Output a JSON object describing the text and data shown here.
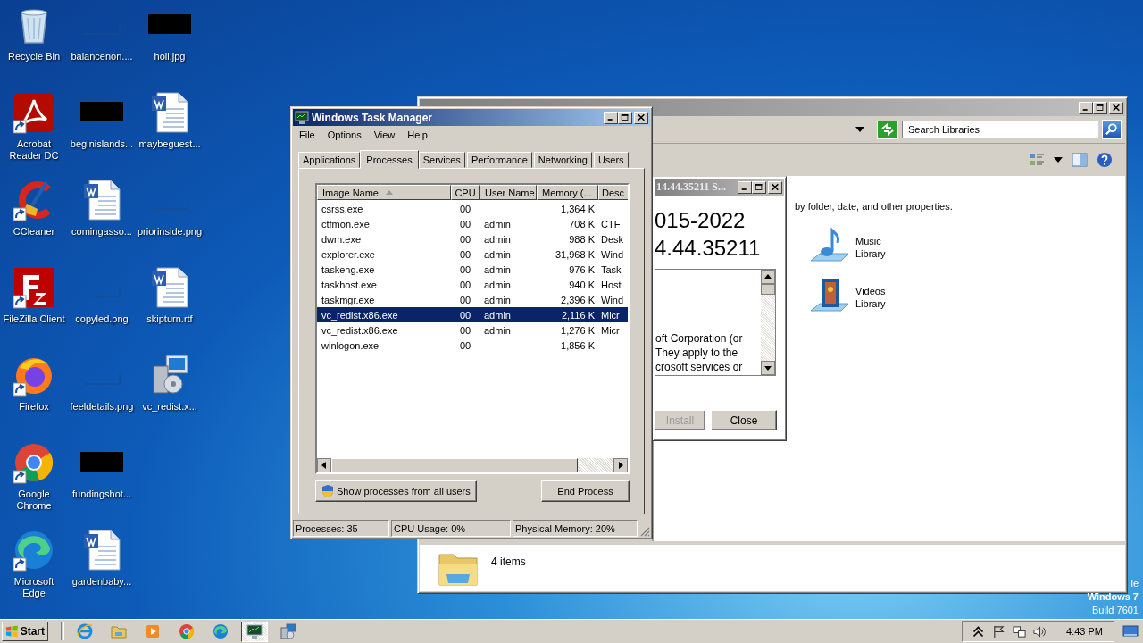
{
  "desktop_icons": [
    {
      "label": "Recycle Bin",
      "kind": "recycle",
      "shortcut": false
    },
    {
      "label": "Acrobat Reader DC",
      "kind": "pdf",
      "shortcut": true
    },
    {
      "label": "CCleaner",
      "kind": "ccleaner",
      "shortcut": true
    },
    {
      "label": "FileZilla Client",
      "kind": "filezilla",
      "shortcut": true
    },
    {
      "label": "Firefox",
      "kind": "firefox",
      "shortcut": true
    },
    {
      "label": "Google Chrome",
      "kind": "chrome",
      "shortcut": true
    },
    {
      "label": "Microsoft Edge",
      "kind": "edge",
      "shortcut": true
    },
    {
      "label": "balancenon....",
      "kind": "blank",
      "shortcut": false
    },
    {
      "label": "beginislands...",
      "kind": "black",
      "shortcut": false
    },
    {
      "label": "comingasso...",
      "kind": "word",
      "shortcut": false
    },
    {
      "label": "copyled.png",
      "kind": "blank",
      "shortcut": false
    },
    {
      "label": "feeldetails.png",
      "kind": "blank",
      "shortcut": false
    },
    {
      "label": "fundingshot...",
      "kind": "black",
      "shortcut": false
    },
    {
      "label": "gardenbaby...",
      "kind": "word",
      "shortcut": false
    },
    {
      "label": "hoil.jpg",
      "kind": "black",
      "shortcut": false
    },
    {
      "label": "maybeguest...",
      "kind": "word",
      "shortcut": false
    },
    {
      "label": "priorinside.png",
      "kind": "blank",
      "shortcut": false
    },
    {
      "label": "skipturn.rtf",
      "kind": "word",
      "shortcut": false
    },
    {
      "label": "vc_redist.x...",
      "kind": "installer",
      "shortcut": false
    }
  ],
  "explorer": {
    "search": {
      "placeholder": "Search Libraries"
    },
    "hint": "by folder, date, and other properties.",
    "libraries": [
      {
        "label": "Music Library",
        "kind": "music"
      },
      {
        "label": "Videos Library",
        "kind": "videos"
      }
    ],
    "status": "4 items"
  },
  "installer": {
    "title": "14.44.35211 S...",
    "heading_lines": [
      "015-2022",
      "4.44.35211"
    ],
    "license_lines": [
      "oft Corporation (or",
      "They apply to the",
      "crosoft services or"
    ],
    "buttons": [
      {
        "label": "Install",
        "disabled": true
      },
      {
        "label": "Close",
        "disabled": false
      }
    ]
  },
  "task_manager": {
    "title": "Windows Task Manager",
    "menu": [
      "File",
      "Options",
      "View",
      "Help"
    ],
    "tabs": [
      {
        "label": "Applications",
        "selected": false
      },
      {
        "label": "Processes",
        "selected": true
      },
      {
        "label": "Services",
        "selected": false
      },
      {
        "label": "Performance",
        "selected": false
      },
      {
        "label": "Networking",
        "selected": false
      },
      {
        "label": "Users",
        "selected": false
      }
    ],
    "table": {
      "columns": [
        "Image Name",
        "CPU",
        "User Name",
        "Memory (...",
        "Desc"
      ],
      "rows": [
        {
          "cells": [
            "csrss.exe",
            "00",
            "",
            "1,364 K",
            ""
          ],
          "selected": false
        },
        {
          "cells": [
            "ctfmon.exe",
            "00",
            "admin",
            "708 K",
            "CTF"
          ],
          "selected": false
        },
        {
          "cells": [
            "dwm.exe",
            "00",
            "admin",
            "988 K",
            "Desk"
          ],
          "selected": false
        },
        {
          "cells": [
            "explorer.exe",
            "00",
            "admin",
            "31,968 K",
            "Wind"
          ],
          "selected": false
        },
        {
          "cells": [
            "taskeng.exe",
            "00",
            "admin",
            "976 K",
            "Task"
          ],
          "selected": false
        },
        {
          "cells": [
            "taskhost.exe",
            "00",
            "admin",
            "940 K",
            "Host"
          ],
          "selected": false
        },
        {
          "cells": [
            "taskmgr.exe",
            "00",
            "admin",
            "2,396 K",
            "Wind"
          ],
          "selected": false
        },
        {
          "cells": [
            "vc_redist.x86.exe",
            "00",
            "admin",
            "2,116 K",
            "Micr"
          ],
          "selected": true
        },
        {
          "cells": [
            "vc_redist.x86.exe",
            "00",
            "admin",
            "1,276 K",
            "Micr"
          ],
          "selected": false
        },
        {
          "cells": [
            "winlogon.exe",
            "00",
            "",
            "1,856 K",
            ""
          ],
          "selected": false
        }
      ]
    },
    "buttons": [
      "Show processes from all users",
      "End Process"
    ],
    "status_bar": [
      "Processes: 35",
      "CPU Usage: 0%",
      "Physical Memory: 20%"
    ]
  },
  "os_watermark": [
    "le",
    "Windows 7",
    "Build 7601"
  ],
  "taskbar": {
    "start": "Start",
    "apps": [
      {
        "kind": "ie",
        "active": false
      },
      {
        "kind": "explorer",
        "active": false
      },
      {
        "kind": "media",
        "active": false
      },
      {
        "kind": "chrome",
        "active": false
      },
      {
        "kind": "edge",
        "active": false
      },
      {
        "kind": "taskmgr",
        "active": true
      },
      {
        "kind": "installer",
        "active": false
      }
    ],
    "clock": "4:43 PM"
  }
}
